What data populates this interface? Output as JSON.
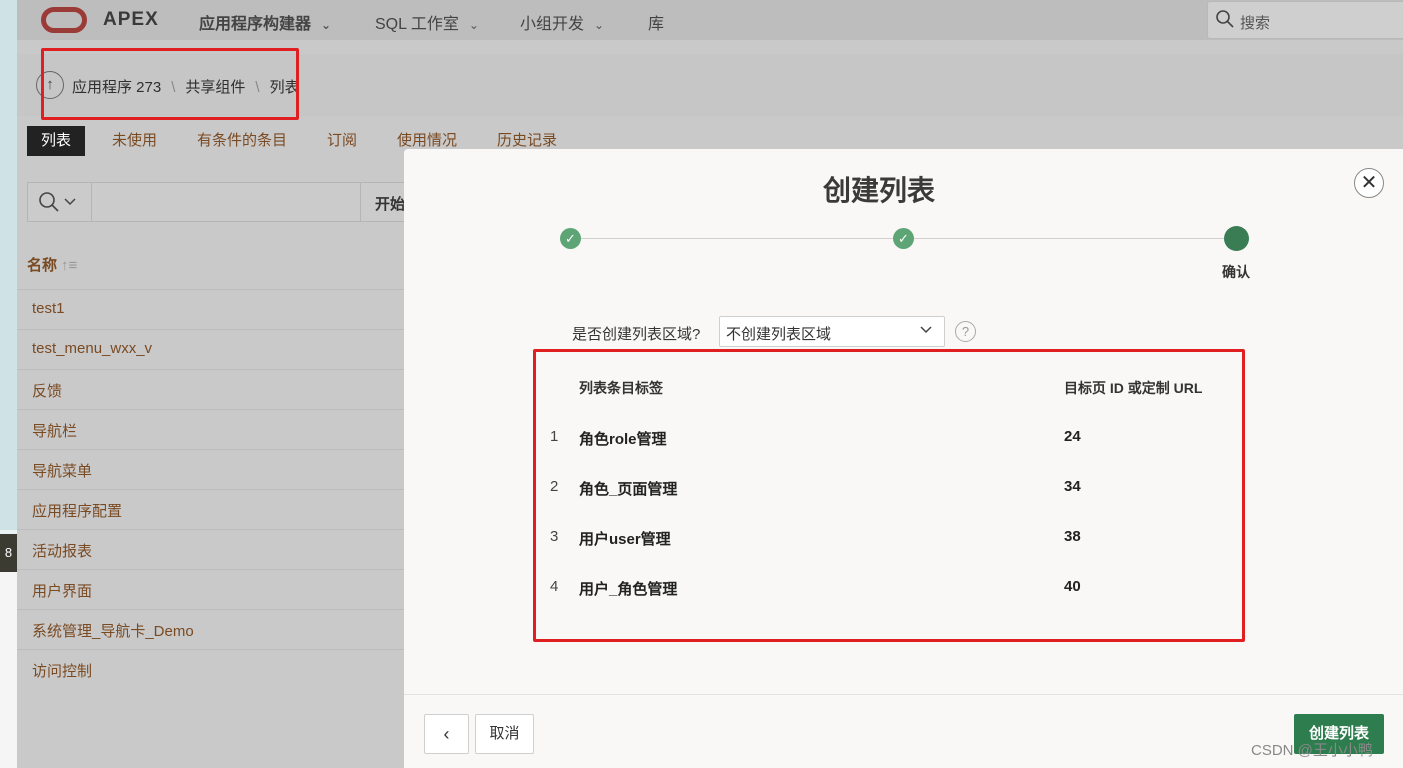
{
  "app": {
    "logo_text": "APEX",
    "nav": [
      {
        "label": "应用程序构建器"
      },
      {
        "label": "SQL 工作室"
      },
      {
        "label": "小组开发"
      },
      {
        "label": "库"
      }
    ],
    "search_placeholder": "搜索"
  },
  "breadcrumb": {
    "items": [
      "应用程序 273",
      "共享组件",
      "列表"
    ]
  },
  "tabs": [
    "列表",
    "未使用",
    "有条件的条目",
    "订阅",
    "使用情况",
    "历史记录"
  ],
  "list_search": {
    "go_label": "开始"
  },
  "list_header": {
    "name_label": "名称",
    "sort_symbol": "↑≡"
  },
  "list_items": [
    "test1",
    "test_menu_wxx_v",
    "反馈",
    "导航栏",
    "导航菜单",
    "应用程序配置",
    "活动报表",
    "用户界面",
    "系统管理_导航卡_Demo",
    "访问控制"
  ],
  "left_badge": "8",
  "modal": {
    "title": "创建列表",
    "close_symbol": "✕",
    "step_done_symbol": "✓",
    "current_step_label": "确认",
    "question_label": "是否创建列表区域?",
    "select_value": "不创建列表区域",
    "help_symbol": "?",
    "table": {
      "col_label": "列表条目标签",
      "col_target": "目标页 ID 或定制 URL",
      "rows": [
        {
          "num": "1",
          "label": "角色role管理",
          "target": "24"
        },
        {
          "num": "2",
          "label": "角色_页面管理",
          "target": "34"
        },
        {
          "num": "3",
          "label": "用户user管理",
          "target": "38"
        },
        {
          "num": "4",
          "label": "用户_角色管理",
          "target": "40"
        }
      ]
    },
    "back_symbol": "‹",
    "cancel_label": "取消",
    "create_label": "创建列表"
  },
  "watermark": "CSDN @王小小鸭"
}
